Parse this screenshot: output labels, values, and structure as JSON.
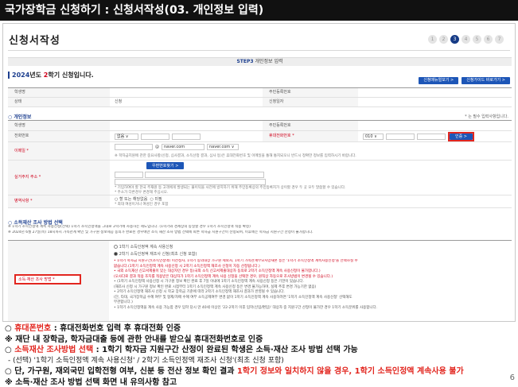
{
  "slide_title": "국가장학금 신청하기 : 신청서작성(03. 개인정보 입력)",
  "page_heading": "신청서작성",
  "steps": [
    "1",
    "2",
    "3",
    "4",
    "5",
    "6",
    "7"
  ],
  "active_step": 3,
  "stepbar": {
    "prefix": "STEP3",
    "text": "개인정보 입력"
  },
  "semester_title": {
    "year": "2024",
    "mid": "년도",
    "sem": "2",
    "suffix": "학기 신청입니다."
  },
  "top_buttons": [
    "신청매뉴얼보기 >",
    "신청가이드 바로가기 >"
  ],
  "info_table": {
    "row1": {
      "th1": "학생명",
      "th2": "주민등록번호"
    },
    "row2": {
      "th1": "상태",
      "td1": "신청",
      "th2": "신청일자"
    }
  },
  "personal": {
    "section_title": "개인정보",
    "required_note": "* 는 필수 입력사항입니다.",
    "row_name": {
      "th1": "학생명",
      "th2": "주민등록번호"
    },
    "row_phone": {
      "th1": "전화번호",
      "phone_select": "없음 ∨",
      "th2": "휴대전화번호 *",
      "mobile_select": "010 ∨",
      "auth_button": "인증 >"
    },
    "row_email": {
      "th": "이메일 *",
      "at": "@",
      "domain_input": "naver.com",
      "domain_select": "naver.com ∨",
      "note": "※ 학자금지원에 관한 중요사항(신청, 심사결과, 소득산정 결과, 심사 등)은 휴대전화번호 및 이메일을 통해 통지되오니 반드시 정확한 정보를 입력하시기 바랍니다."
    },
    "row_address": {
      "th": "실거주지 주소 *",
      "button": "우편번호찾기 >",
      "note1": "* 기입하여야 할 한국 주재원 등 고객에게 발생되는 불이익을 사전에 방지하기 위해 주민등록상의 주민등록지가 상이할 경우 두 곳 모두 말씀할 수 있습니다.",
      "note2": "* 주소가 다른경우 변경해 주십시오."
    },
    "row_military": {
      "th": "병역사항 *",
      "opt1": "○ 할 또는 해당없음",
      "opt2": "○ 미필",
      "note": "* 최대 여성이거나 여성인 경우 포함"
    }
  },
  "income": {
    "section_title": "소득재산 조사 방법 선택",
    "line1": "※ 1학기 소득인정액 계속 사용신청(선택) 1학기 소득인정액을 그대로 2학기에 사용하는 제도입니다. (1학기와 경제상의 동일할 경우 1학기 소득인정액 적용 확정)",
    "line2": "※ 2024년 6월 27일(목) 18시까지 가족관계 확인 및 가구원 정보제공 동의가 완료된 경우에만 소득 재산 조사 방법 선택에 따른 학자금 지원구간이 산정되며, 이후에는 학자금 지원구간 산정이 불가합니다.",
    "th": "소득·재산 조사 방법 *",
    "opt1": "1학기 소득인정액 계속 사용신청",
    "opt2": "2학기 소득인정액 재조사 신청(최초 신청 포함)",
    "notes": [
      "• 1학기 학자금 지원구간(소득인정액) 미산정자, 1학기 동의대상 가구원 제외자, 1학기 가족관계부모사망재혼 등은 '1학기 소득인정액 계속사용신청'을 선택하실 수",
      "  없습니다.(1학기 소득인정액 계속 사용신청 시 2학기 소득인정액 재조사 신청이 자동 산정됩니다.)",
      "• 국외 소득재산 신고서제출이 있는 대상자인 경우 등(국외 소득 신고서제출대상자 동의로 2학기 소득인정액 계속 사용신청이 불가합니다.)",
      "  (오사다로 결과 적용 조치를 적용받은 대상자가 1학기 소득인정액 계속 사용 신청을 선택한 경우, 원칙상 자동으로 조사방법이 변경될 수 있습니다.)",
      "• (1학기 소득인정액 사용신청 시 가구원 정보 확인 완료 후 7일 이내에 1학기 소득인정액 계속 사용신청 등은 기한이 있습니다.",
      "  (재조사 신청 시 가구원 정보 확인 완료 시점부터 1학기 소득인정액 계속 사용신청 등은 변경 불가능하며, 실제 추후 변경 가능기한 없음)",
      "• 2학기 소득인정액 재조사 신청 시 학교 장학금 기준에 따라 2학기 소득인정액 재조사 결과가 반영될 수 있습니다.",
      "  (단, 타대, 국가장학금 수혜 여부 및 형제/자매 수혜 여부 소득공제여부 변경 없이 1학기 소득인정액 계속 사용하려면 '1학기 소득인정액 계속 사용신청' 선택해도",
      "  무관합니다.)",
      "• 1학기 소득인정액을 계속 사용 가능함 경우 입학 당시 만 40세 이상인 '22-2학기 이후 입학(신입/편입)' 대상자 중 지원구간 산정이 불가한 경우 1학기 소득분위를 사용합니다."
    ]
  },
  "bottom_lines": [
    {
      "p": "○ ",
      "r": "휴대폰번호",
      "t": " : 휴대전화번호 입력 후 휴대전화 인증"
    },
    {
      "p": "※ 재단 내 장학금, 학자금대출 등에 관한 안내를 받으실 휴대전화번호로 인증"
    },
    {
      "p": "○ ",
      "r": "소득재산 조사방법 선택",
      "t": " : 1학기 학자금 지원구간 산정이 완료된 학생은 소득·재산 조사 방법 선택 가능"
    },
    {
      "p": "- (선택) '1학기 소득인정액 계속 사용신청' / 2학기 소득인정액 재조사 신청'(최초 신청 포함)",
      "sub": true
    },
    {
      "p": "○ 단, 가구원, 재외국민 입학전형 여부, 신분 등 전산 정보 확인 결과 ",
      "r": "1학기 정보와 일치하지 않을 경우, 1학기 소득인정액 계속사용 불가"
    },
    {
      "p": "※ 소득·재산 조사 방법 선택 화면 내 유의사항 참고"
    }
  ],
  "page_number": "6"
}
